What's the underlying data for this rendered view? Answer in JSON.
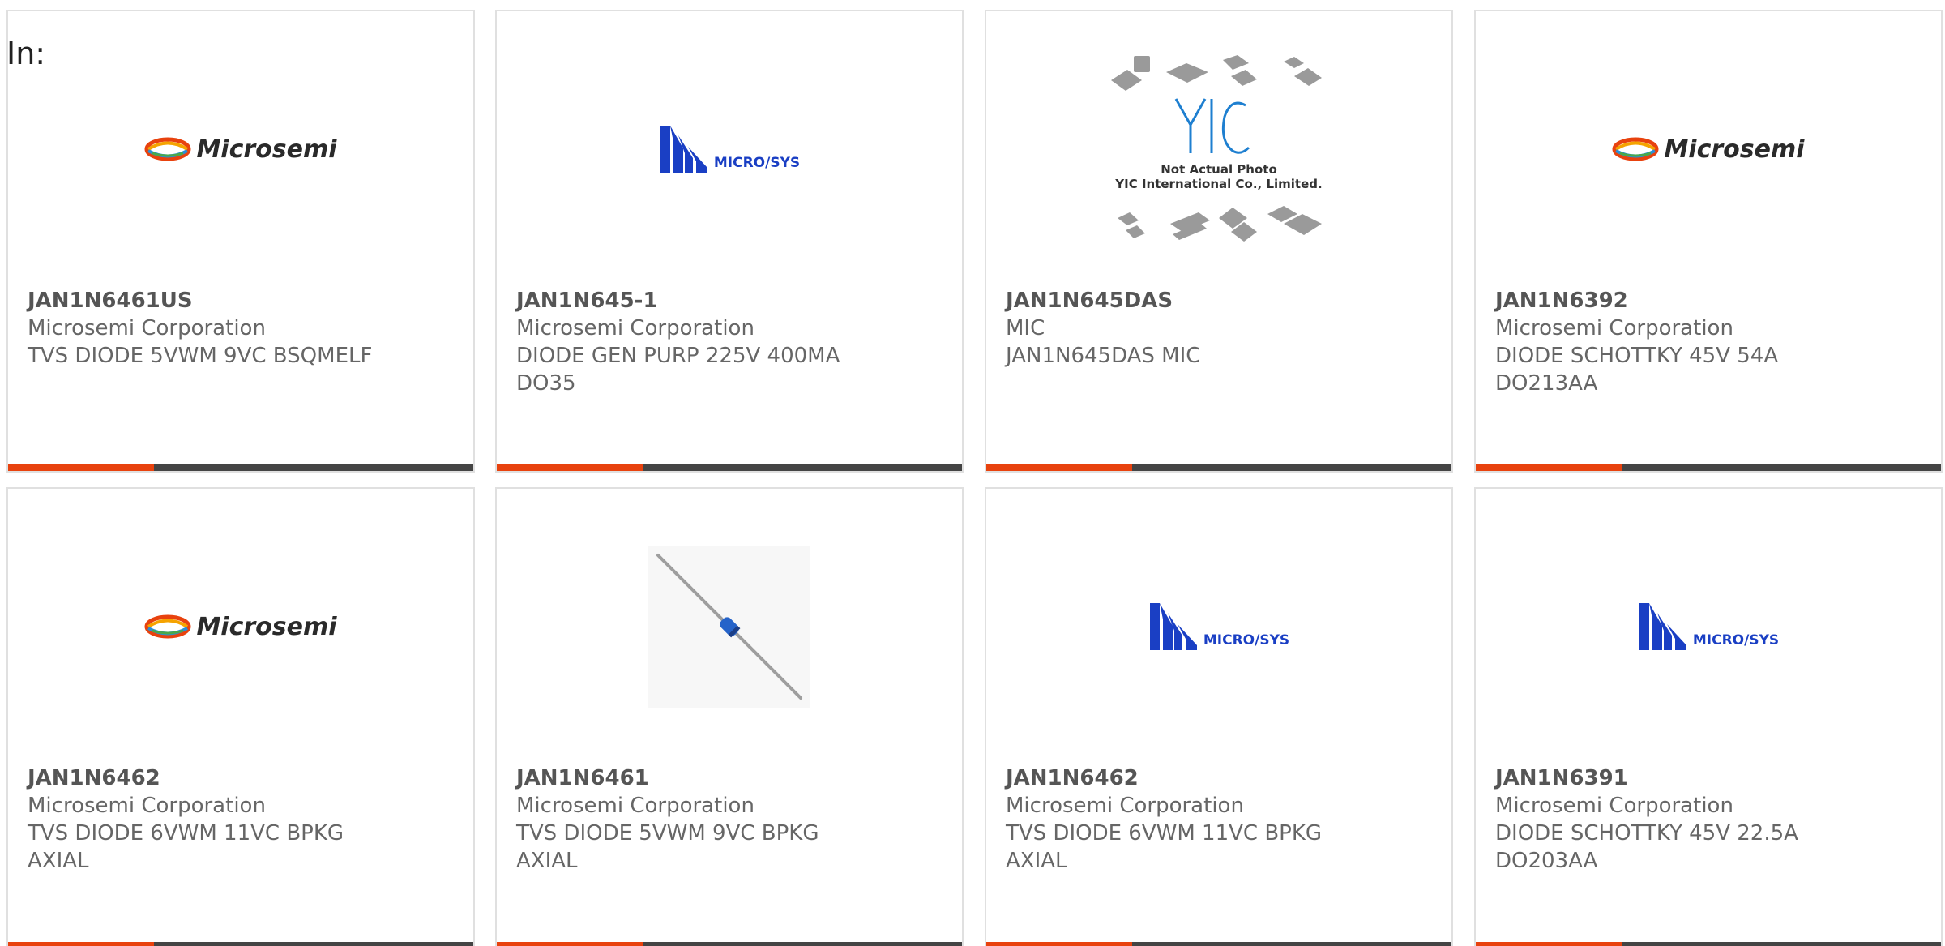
{
  "header": {
    "in_label": "In:"
  },
  "brands": {
    "microsemi": "Microsemi",
    "microsys": "MICRO/SYS",
    "yic_logo": "YIC",
    "yic_line1": "Not Actual Photo",
    "yic_line2": "YIC International Co., Limited."
  },
  "colors": {
    "accent": "#e8420e",
    "bar": "#444444",
    "border": "#e0e0e0",
    "text": "#666666",
    "microsys_blue": "#1a3fc4"
  },
  "cards": [
    {
      "part": "JAN1N6461US",
      "mfr": "Microsemi Corporation",
      "desc1": "TVS DIODE 5VWM 9VC BSQMELF",
      "desc2": "",
      "image": "microsemi-logo"
    },
    {
      "part": "JAN1N645-1",
      "mfr": "Microsemi Corporation",
      "desc1": "DIODE GEN PURP 225V 400MA",
      "desc2": "DO35",
      "image": "microsys-logo"
    },
    {
      "part": "JAN1N645DAS",
      "mfr": "MIC",
      "desc1": "JAN1N645DAS MIC",
      "desc2": "",
      "image": "yic-placeholder"
    },
    {
      "part": "JAN1N6392",
      "mfr": "Microsemi Corporation",
      "desc1": "DIODE SCHOTTKY 45V 54A",
      "desc2": "DO213AA",
      "image": "microsemi-logo"
    },
    {
      "part": "JAN1N6462",
      "mfr": "Microsemi Corporation",
      "desc1": "TVS DIODE 6VWM 11VC BPKG",
      "desc2": "AXIAL",
      "image": "microsemi-logo"
    },
    {
      "part": "JAN1N6461",
      "mfr": "Microsemi Corporation",
      "desc1": "TVS DIODE 5VWM 9VC BPKG",
      "desc2": "AXIAL",
      "image": "diode-photo"
    },
    {
      "part": "JAN1N6462",
      "mfr": "Microsemi Corporation",
      "desc1": "TVS DIODE 6VWM 11VC BPKG",
      "desc2": "AXIAL",
      "image": "microsys-logo"
    },
    {
      "part": "JAN1N6391",
      "mfr": "Microsemi Corporation",
      "desc1": "DIODE SCHOTTKY 45V 22.5A",
      "desc2": "DO203AA",
      "image": "microsys-logo"
    }
  ]
}
